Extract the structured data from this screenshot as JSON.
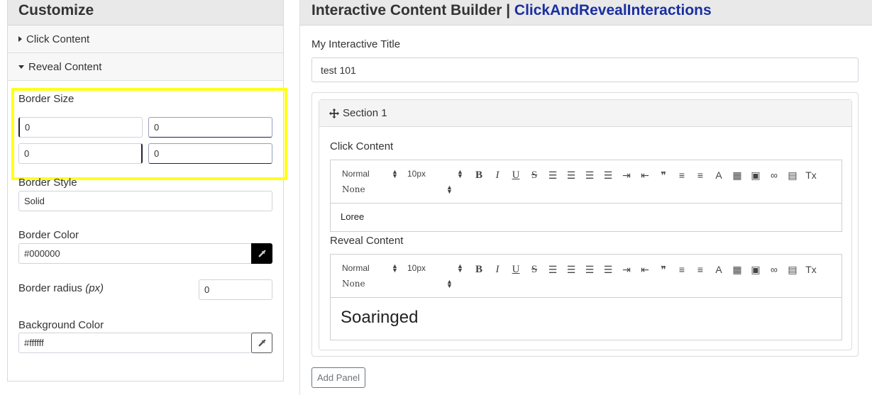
{
  "customize": {
    "title": "Customize",
    "accordion": [
      {
        "label": "Click Content",
        "expanded": false
      },
      {
        "label": "Reveal Content",
        "expanded": true
      }
    ],
    "border_size": {
      "label": "Border Size",
      "values": [
        "0",
        "0",
        "0",
        "0"
      ]
    },
    "border_style": {
      "label": "Border Style",
      "value": "Solid"
    },
    "border_color": {
      "label": "Border Color",
      "value": "#000000",
      "swatch": "#000000"
    },
    "border_radius": {
      "label": "Border radius ",
      "unit": "(px)",
      "value": "0"
    },
    "background_color": {
      "label": "Background Color",
      "value": "#ffffff",
      "swatch": "#ffffff"
    },
    "highlight_color": "#ffff1a"
  },
  "builder": {
    "title": "Interactive Content Builder | ",
    "breadcrumb": "ClickAndRevealInteractions",
    "accent_color": "#1a2fa0",
    "title_field_label": "My Interactive Title",
    "title_field_value": "test 101",
    "section": {
      "label": "Section 1",
      "click_label": "Click Content",
      "click_body": "Loree",
      "reveal_label": "Reveal Content",
      "reveal_body": "Soaringed"
    },
    "toolbar": {
      "format": "Normal",
      "size": "10px",
      "font": "None",
      "icons": [
        "bold-icon",
        "italic-icon",
        "underline-icon",
        "strikethrough-icon",
        "align-left-icon",
        "align-center-icon",
        "align-right-icon",
        "align-justify-icon",
        "indent-icon",
        "outdent-icon",
        "blockquote-icon",
        "ordered-list-icon",
        "bullet-list-icon",
        "font-color-icon",
        "background-color-icon",
        "image-icon",
        "link-icon",
        "video-icon",
        "clear-format-icon"
      ]
    },
    "add_panel_label": "Add Panel"
  }
}
